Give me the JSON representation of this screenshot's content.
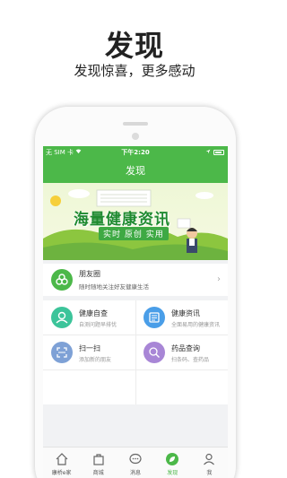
{
  "promo": {
    "title": "发现",
    "subtitle": "发现惊喜，更多感动"
  },
  "status_bar": {
    "carrier": "无 SIM 卡",
    "time": "下午2:20"
  },
  "nav": {
    "title": "发现"
  },
  "banner": {
    "title": "海量健康资讯",
    "tags": "实时 原创 实用"
  },
  "friends_card": {
    "title": "朋友圈",
    "subtitle": "随时随地关注好友健康生活"
  },
  "features": [
    {
      "title": "健康自查",
      "subtitle": "自测问题早排忧",
      "icon": "person-check-icon",
      "color": "#3cc49a"
    },
    {
      "title": "健康资讯",
      "subtitle": "全面易用的健康资讯",
      "icon": "news-icon",
      "color": "#4a9ee8"
    },
    {
      "title": "扫一扫",
      "subtitle": "添加新的朋友",
      "icon": "scan-icon",
      "color": "#7ea1d6"
    },
    {
      "title": "药品查询",
      "subtitle": "扫条码、查药品",
      "icon": "pill-search-icon",
      "color": "#a886d6"
    }
  ],
  "tabs": [
    {
      "label": "康桥e家",
      "icon": "home-icon"
    },
    {
      "label": "商城",
      "icon": "bag-icon"
    },
    {
      "label": "消息",
      "icon": "chat-icon"
    },
    {
      "label": "发现",
      "icon": "leaf-icon",
      "active": true
    },
    {
      "label": "我",
      "icon": "user-icon"
    }
  ],
  "colors": {
    "brand_green": "#4cb849",
    "friends_icon": "#4cb849"
  }
}
